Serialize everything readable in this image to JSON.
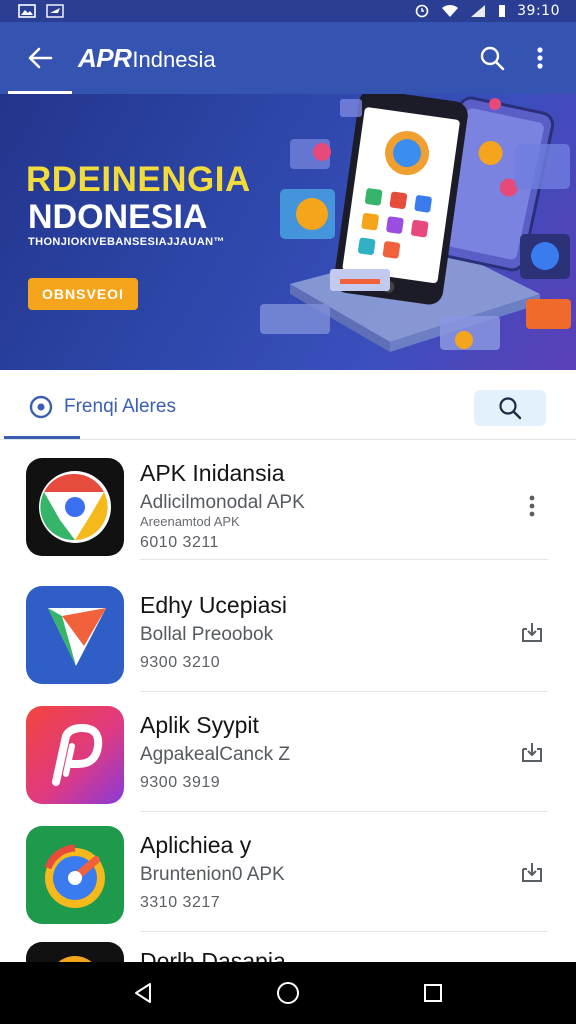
{
  "status_bar": {
    "time": "39:10",
    "left_icons": [
      "gallery-icon",
      "airplane-icon"
    ],
    "right_icons": [
      "alarm-icon",
      "wifi-icon",
      "signal-icon",
      "battery-icon"
    ]
  },
  "app_bar": {
    "brand_strong": "APR",
    "brand_rest": "Indnesia",
    "back_icon": "arrow-left-icon",
    "search_icon": "search-icon",
    "more_icon": "more-vertical-icon"
  },
  "banner": {
    "title_line1": "RDEINENGIA",
    "title_line2": "NDONESIA",
    "tagline": "THONJIOKIVEBANSESIAJJAUAN™",
    "cta_label": "OBNSVEOI"
  },
  "search": {
    "label": "Frenqi Aleres",
    "icon": "search-icon"
  },
  "apps": [
    {
      "name": "APK Inidansia",
      "subtitle": "Adlicilmonodal APK",
      "subtitle2": "Areenamtod APK",
      "meta": "6010  3211",
      "action_icon": "more-vertical-icon"
    },
    {
      "name": "Edhy Ucepiasi",
      "subtitle": "Bollal Preoobok",
      "meta": "9300  3210",
      "action_icon": "download-icon"
    },
    {
      "name": "Aplik Syypit",
      "subtitle": "AgpakealCanck  Z",
      "meta": "9300  3919",
      "action_icon": "download-icon"
    },
    {
      "name": "Aplichiea y",
      "subtitle": "Bruntenion0 APK",
      "meta": "3310  3217",
      "action_icon": "download-icon"
    },
    {
      "name": "Dorlh Dasapia"
    }
  ],
  "nav": {
    "back": "nav-back-icon",
    "home": "nav-home-icon",
    "recents": "nav-recents-icon"
  },
  "colors": {
    "app_bar": "#3553b1",
    "status_bar": "#2a3f93",
    "accent_yellow": "#f2dc3b",
    "cta_orange": "#f5a51c",
    "link_blue": "#3a5fb0"
  }
}
